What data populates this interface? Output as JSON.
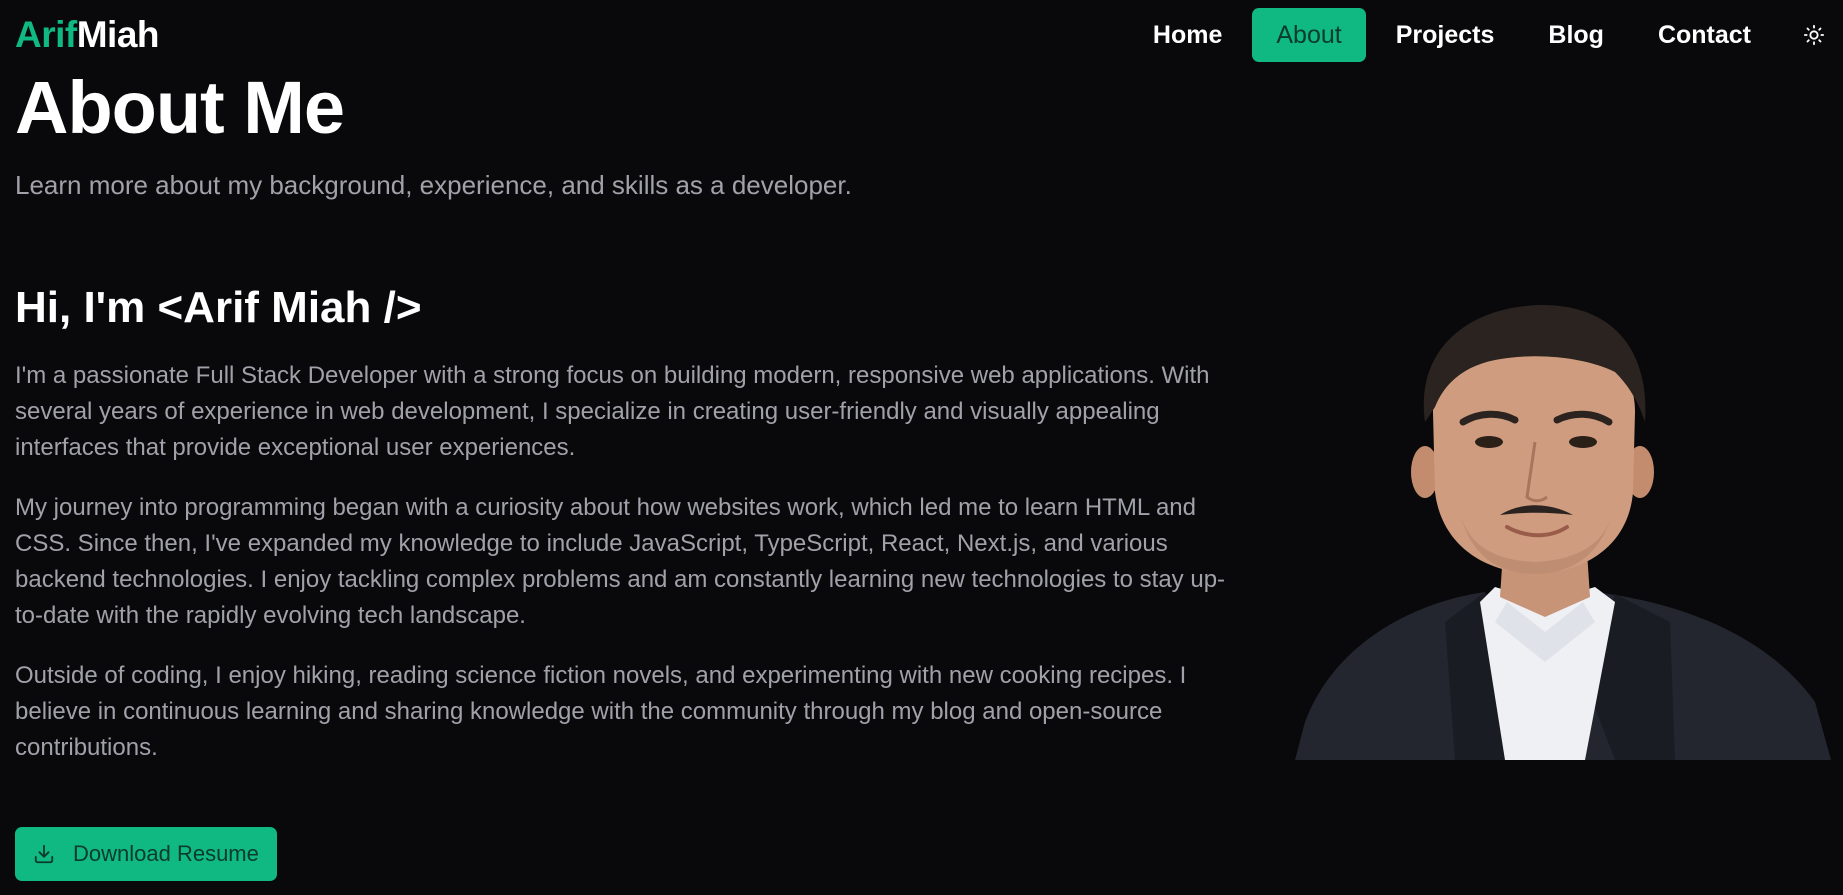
{
  "brand": {
    "first": "Arif",
    "last": "Miah",
    "accent_color": "#10b981"
  },
  "nav": {
    "items": [
      {
        "label": "Home",
        "active": false
      },
      {
        "label": "About",
        "active": true
      },
      {
        "label": "Projects",
        "active": false
      },
      {
        "label": "Blog",
        "active": false
      },
      {
        "label": "Contact",
        "active": false
      }
    ],
    "theme_toggle_icon": "sun-icon"
  },
  "page": {
    "title": "About Me",
    "subtitle": "Learn more about my background, experience, and skills as a developer."
  },
  "intro": {
    "heading": "Hi, I'm <Arif Miah />",
    "paragraphs": [
      "I'm a passionate Full Stack Developer with a strong focus on building modern, responsive web applications. With several years of experience in web development, I specialize in creating user-friendly and visually appealing interfaces that provide exceptional user experiences.",
      "My journey into programming began with a curiosity about how websites work, which led me to learn HTML and CSS. Since then, I've expanded my knowledge to include JavaScript, TypeScript, React, Next.js, and various backend technologies. I enjoy tackling complex problems and am constantly learning new technologies to stay up-to-date with the rapidly evolving tech landscape.",
      "Outside of coding, I enjoy hiking, reading science fiction novels, and experimenting with new cooking recipes. I believe in continuous learning and sharing knowledge with the community through my blog and open-source contributions."
    ]
  },
  "actions": {
    "download_label": "Download Resume",
    "download_icon": "download-icon"
  },
  "colors": {
    "background": "#09090b",
    "muted_text": "#a1a1aa",
    "accent": "#10b981"
  }
}
